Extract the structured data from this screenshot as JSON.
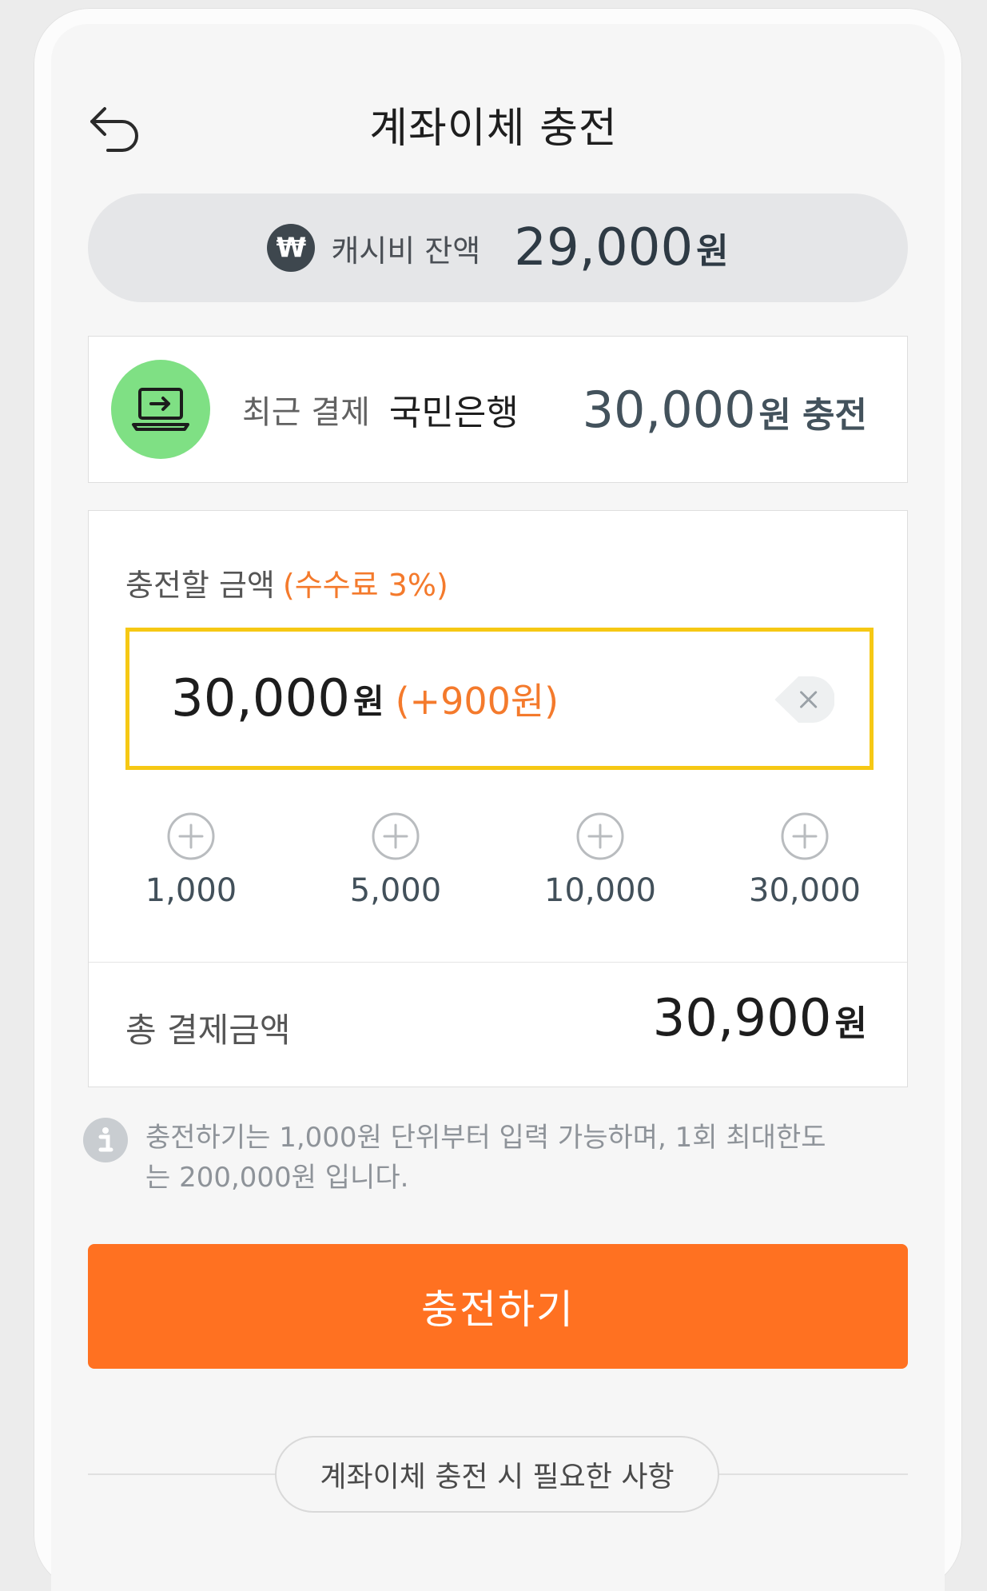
{
  "header": {
    "title": "계좌이체 충전",
    "back_icon": "back-arrow-icon"
  },
  "balance": {
    "icon_glyph": "₩",
    "label": "캐시비 잔액",
    "amount": "29,000",
    "unit": "원"
  },
  "recent_payment": {
    "icon": "laptop-transfer-icon",
    "label": "최근 결제",
    "bank": "국민은행",
    "amount": "30,000",
    "unit": "원",
    "action": "충전"
  },
  "charge": {
    "label": "충전할 금액",
    "fee": "(수수료 3%)",
    "input": {
      "value": "30,000",
      "unit": "원",
      "fee_amount": "(+900원)"
    },
    "quick_add": [
      {
        "label": "1,000"
      },
      {
        "label": "5,000"
      },
      {
        "label": "10,000"
      },
      {
        "label": "30,000"
      }
    ],
    "total": {
      "label": "총 결제금액",
      "amount": "30,900",
      "unit": "원"
    }
  },
  "notice": {
    "text": "충전하기는 1,000원 단위부터 입력 가능하며, 1회 최대한도는 200,000원 입니다."
  },
  "charge_button": "충전하기",
  "requirements_button": "계좌이체 충전 시 필요한 사항",
  "colors": {
    "accent_orange": "#ff7121",
    "fee_orange": "#f47a2c",
    "input_border": "#f6c814",
    "laptop_bg": "#7fe084"
  }
}
